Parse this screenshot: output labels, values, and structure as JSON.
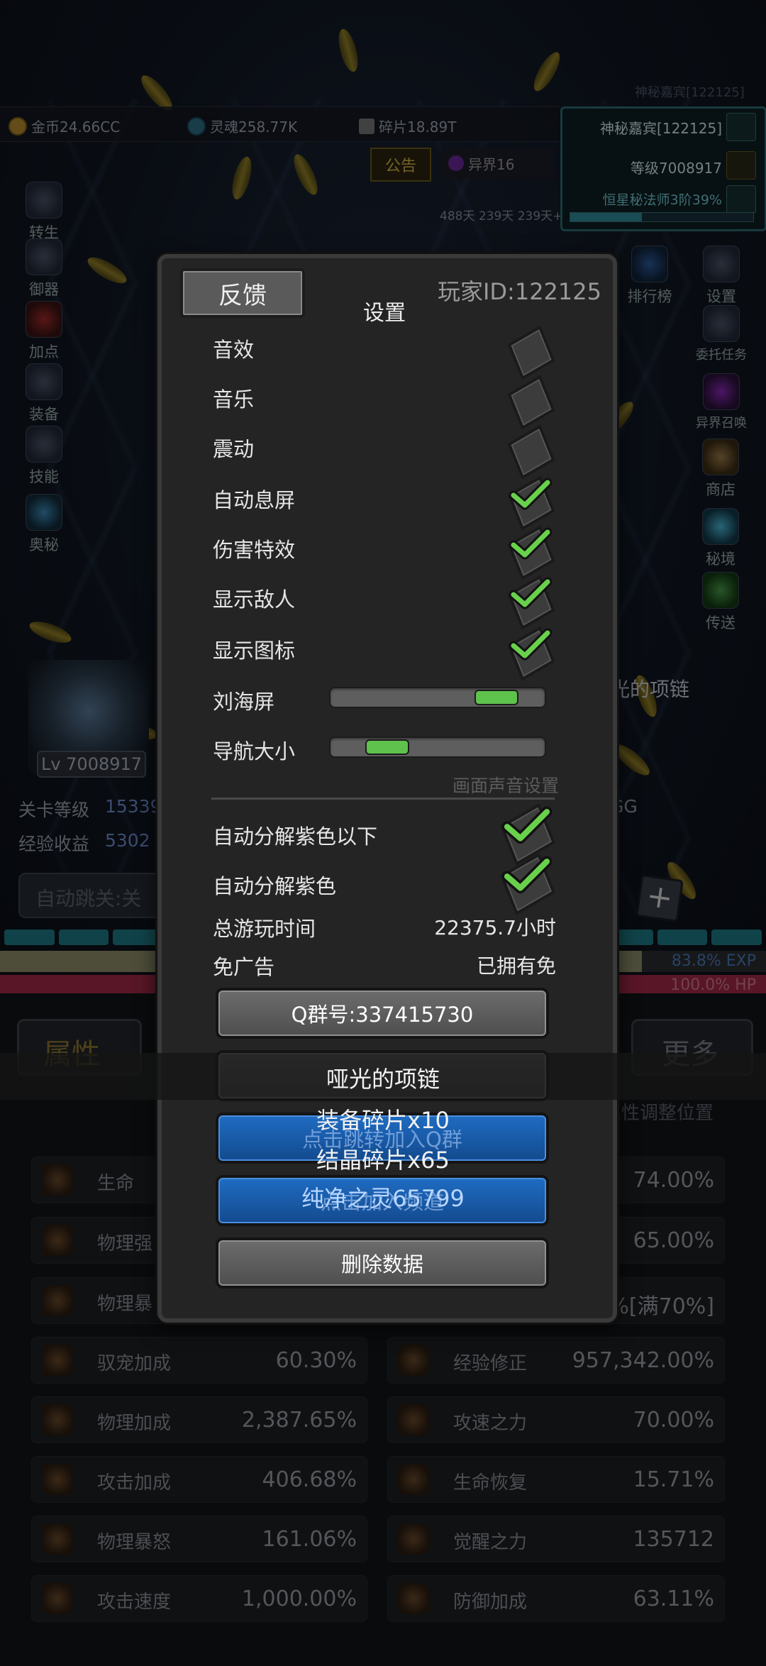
{
  "top_resources": [
    {
      "label": "金币24.66CC"
    },
    {
      "label": "灵魂258.77K"
    },
    {
      "label": "碎片18.89T"
    }
  ],
  "faded_title": "神秘嘉宾[122125]",
  "notice_label": "公告",
  "otherworld_label": "异界16",
  "buff_timers": "488天 239天 239天+",
  "vip": {
    "name": "神秘嘉宾[122125]",
    "level": "等级7008917",
    "rank": "恒星秘法师3阶39%",
    "rank_progress": 0.39
  },
  "left_menu": [
    "转生",
    "御器",
    "加点",
    "装备",
    "技能",
    "奥秘"
  ],
  "right_menu": [
    "排行榜",
    "设置",
    "委托任务",
    "异界召唤",
    "商店",
    "秘境",
    "传送"
  ],
  "player_level": "Lv 7008917",
  "stage_level_label": "关卡等级",
  "stage_level_value": "15339",
  "exp_gain_label": "经验收益",
  "exp_gain_value": "5302",
  "auto_skip_label": "自动跳关:关",
  "equip_name_behind": "光的项链",
  "gg_text": "GG",
  "exp_bar": {
    "label": "83.8% EXP",
    "ratio": 0.838
  },
  "hp_bar": {
    "label": "100.0% HP",
    "ratio": 1.0
  },
  "attr_tab": "属性",
  "more_tab": "更多",
  "attr_adjust_hint": "属性调整位置",
  "stats_left": [
    {
      "name": "生命",
      "value": ""
    },
    {
      "name": "物理强",
      "value": ""
    },
    {
      "name": "物理暴",
      "value": ""
    },
    {
      "name": "驭宠加成",
      "value": "60.30%"
    },
    {
      "name": "物理加成",
      "value": "2,387.65%"
    },
    {
      "name": "攻击加成",
      "value": "406.68%"
    },
    {
      "name": "物理暴怒",
      "value": "161.06%"
    },
    {
      "name": "攻击速度",
      "value": "1,000.00%"
    }
  ],
  "stats_right": [
    {
      "name": "",
      "value": "74.00%"
    },
    {
      "name": "",
      "value": "65.00%"
    },
    {
      "name": "",
      "value": "%[满70%]"
    },
    {
      "name": "经验修正",
      "value": "957,342.00%"
    },
    {
      "name": "攻速之力",
      "value": "70.00%"
    },
    {
      "name": "生命恢复",
      "value": "15.71%"
    },
    {
      "name": "觉醒之力",
      "value": "135712"
    },
    {
      "name": "防御加成",
      "value": "63.11%"
    }
  ],
  "settings": {
    "feedback_label": "反馈",
    "title": "设置",
    "player_id": "玩家ID:122125",
    "toggles": [
      {
        "label": "音效",
        "checked": false
      },
      {
        "label": "音乐",
        "checked": false
      },
      {
        "label": "震动",
        "checked": false
      },
      {
        "label": "自动息屏",
        "checked": true
      },
      {
        "label": "伤害特效",
        "checked": true
      },
      {
        "label": "显示敌人",
        "checked": true
      },
      {
        "label": "显示图标",
        "checked": true
      }
    ],
    "sliders": [
      {
        "label": "刘海屏",
        "value": 0.85
      },
      {
        "label": "导航大小",
        "value": 0.2
      }
    ],
    "section_hint": "画面声音设置",
    "decompose": [
      {
        "label": "自动分解紫色以下",
        "checked": true
      },
      {
        "label": "自动分解紫色",
        "checked": true
      }
    ],
    "playtime_label": "总游玩时间",
    "playtime_value": "22375.7小时",
    "adfree_label": "免广告",
    "adfree_value": "已拥有免",
    "qq_group": "Q群号:337415730",
    "join_qq_faded": "点击跳转加入Q群",
    "extra_faded": "点击加入频道",
    "delete_label": "删除数据"
  },
  "reward_toast": {
    "title": "哑光的项链",
    "lines": [
      "装备碎片x10",
      "结晶碎片x65",
      "纯净之灵65799"
    ]
  }
}
